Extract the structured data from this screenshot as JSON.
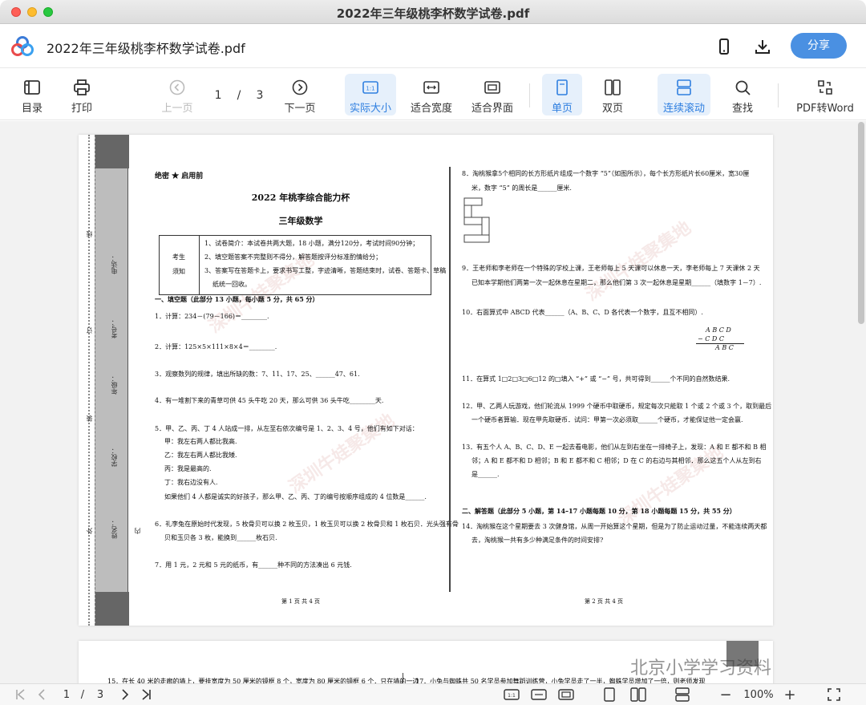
{
  "window": {
    "title": "2022年三年级桃李杯数学试卷.pdf"
  },
  "header": {
    "doc_name": "2022年三年级桃李杯数学试卷.pdf",
    "share_label": "分享"
  },
  "toolbar": {
    "toc": "目录",
    "print": "打印",
    "prev": "上一页",
    "current_page": "1",
    "slash": "/",
    "total_pages": "3",
    "next": "下一页",
    "actual_size": "实际大小",
    "fit_width": "适合宽度",
    "fit_page": "适合界面",
    "single_page": "单页",
    "double_page": "双页",
    "continuous": "连续滚动",
    "find": "查找",
    "pdf_to_word": "PDF转Word"
  },
  "bottom": {
    "current_page": "1",
    "slash": "/",
    "total_pages": "3",
    "zoom": "100%",
    "minus": "−",
    "plus": "+"
  },
  "watermark": {
    "text": "北京小学学习资料",
    "repeat": "深圳牛娃聚集地"
  },
  "binding": {
    "name": "姓名：",
    "school": "学校：",
    "grade": "年级：",
    "exam_no": "考号：",
    "phone": "电话：",
    "wai": "外",
    "nei": "内",
    "zhuang": "装",
    "ding": "订",
    "xian": "线"
  },
  "exam": {
    "secret": "绝密 ★ 启用前",
    "title": "2022 年桃李综合能力杯",
    "subtitle": "三年级数学",
    "notes_label1": "考生",
    "notes_label2": "须知",
    "note1": "1、试卷简介：本试卷共两大题，18 小题，满分120分，考试时间90分钟；",
    "note2": "2、填空题答案不完整则不得分，解答题按评分标准酌情给分；",
    "note3": "3、答案写在答题卡上，要求书写工整，字迹清晰，答题结束时，试卷、答题卡、草稿",
    "note3b": "纸统一回收。",
    "section1": "一、填空题（此部分 13 小题，每小题 5 分，共 65 分）",
    "q1": "1．计算：234－(79－166)＝________.",
    "q2": "2．计算：125×5×111×8×4＝________.",
    "q3": "3．观察数列的规律，填出所缺的数：7、11、17、25、______47、61.",
    "q4": "4．有一堆割下来的青草可供 45 头牛吃 20 天，那么可供 36 头牛吃________天.",
    "q5": "5．甲、乙、丙、丁 4 人站成一排，从左至右依次编号是 1、2、3、4 号，他们有如下对话：",
    "q5a": "甲：我左右两人都比我高.",
    "q5b": "乙：我左右两人都比我矮.",
    "q5c": "丙：我是最高的.",
    "q5d": "丁：我右边没有人.",
    "q5e": "如果他们 4 人都是诚实的好孩子，那么甲、乙、丙、丁的编号按顺序组成的 4 位数是______.",
    "q6": "6．礼李兔在原始时代发现，5 枚骨贝可以换 2 枚玉贝，1 枚玉贝可以换 2 枚骨贝和 1 枚石贝．光头强有骨",
    "q6b": "贝和玉贝各 3 枚，能换到______枚石贝.",
    "q7": "7．用 1 元，2 元和 5 元的纸币，有______种不同的方法凑出 6 元钱.",
    "footer1": "第 1 页 共 4 页",
    "q8": "8．淘桃猴拿5个相同的长方形纸片组成一个数字 “5”（如图所示），每个长方形纸片长60厘米，宽30厘",
    "q8b": "米，数字 “5” 的周长是______厘米.",
    "q9": "9．王老师和李老师在一个特殊的学校上课，王老师每上 5 天课可以休息一天，李老师每上 7 天课休 2 天",
    "q9b": "已知本学期他们两第一次一起休息在星期二，那么他们第 3 次一起休息是星期______（填数字 1－7）.",
    "q10": "10．右面算式中 ABCD 代表______（A、B、C、D 各代表一个数字，且互不相同）.",
    "sum_r1": "A  B  C  D",
    "sum_r2": "−     C  D  C",
    "sum_r3": "A  B  C",
    "q11": "11．在算式 1□2□3□6□12 的□填入 “+” 或 “−” 号，共可得到______个不同的自然数结果.",
    "q12": "12．甲、乙两人玩游戏，他们轮流从 1999 个硬币中取硬币，规定每次只能取 1 个或 2 个或 3 个，取到最后",
    "q12b": "一个硬币者算输．现在甲先取硬币．试问：甲第一次必须取______个硬币，才能保证他一定会赢.",
    "q13": "13．有五个人 A、B、C、D、E 一起去看电影，他们从左到右坐在一排椅子上，发现：A 和 E 都不和 B 相",
    "q13b": "邻；A 和 E 都不和 D 相邻；B 和 E 都不和 C 相邻；D 在 C 的右边与其相邻．那么这五个人从左到右",
    "q13c": "是______.",
    "section2": "二、解答题（此部分 5 小题，第 14–17 小题每题 10 分，第 18 小题每题 15 分，共 55 分）",
    "q14": "14．淘桃猴在这个星期要去 3 次健身馆，从周一开始算这个星期，但是为了防止运动过量，不能连续两天都",
    "q14b": "去，淘桃猴一共有多少种满足条件的时间安排?",
    "footer2": "第 2 页 共 4 页",
    "q15": "15．在长 40 米的走廊的墙上，要挂宽度为 50 厘米的镜框 8 个，宽度为 80 厘米的镜框 6 个．只在墙的一边",
    "q17": "17．小兔与蜘蛛共 50 名学员参加舞蹈训练营，小兔学员走了一半，蜘蛛学员增加了一倍，则老师发现"
  }
}
